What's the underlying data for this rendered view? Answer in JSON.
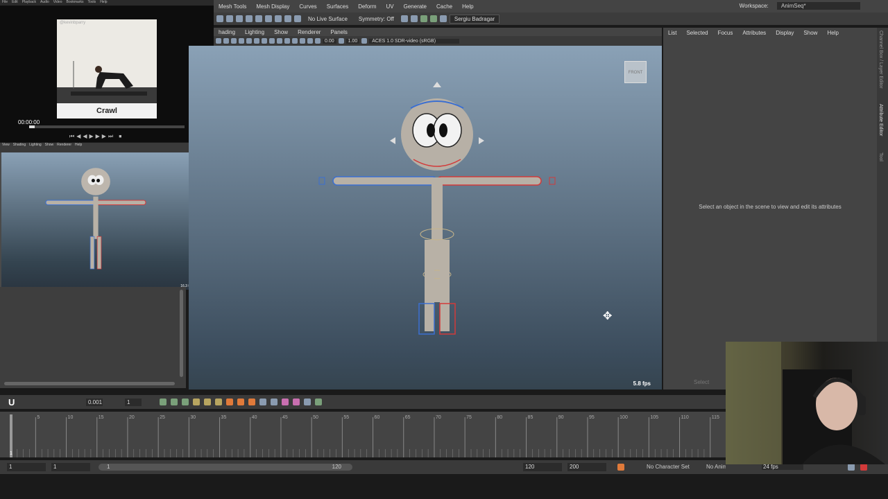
{
  "menubar": {
    "items": [
      "Mesh Tools",
      "Mesh Display",
      "Curves",
      "Surfaces",
      "Deform",
      "UV",
      "Generate",
      "Cache",
      "Help"
    ],
    "workspace_label": "Workspace:",
    "workspace_value": "AnimSeq*"
  },
  "shelf": {
    "live_surface": "No Live Surface",
    "symmetry": "Symmetry: Off",
    "user": "Sergiu Badragar"
  },
  "panel": {
    "menu": [
      "hading",
      "Lighting",
      "Show",
      "Renderer",
      "Panels"
    ],
    "exposure": "0.00",
    "gamma": "1.00",
    "colorspace": "ACES 1.0 SDR-video (sRGB)",
    "fps": "5.8 fps",
    "viewcube": "FRONT"
  },
  "attribute_editor": {
    "menu": [
      "List",
      "Selected",
      "Focus",
      "Attributes",
      "Display",
      "Show",
      "Help"
    ],
    "message": "Select an object in the scene to view and edit its attributes",
    "select_label": "Select",
    "side_tabs": [
      "Channel Box / Layer Editor",
      "Attribute Editor",
      "Tool"
    ]
  },
  "timebar": {
    "u_label": "U",
    "step_value": "0.001",
    "frame_value": "1"
  },
  "timeline": {
    "ticks": [
      "5",
      "10",
      "15",
      "20",
      "25",
      "30",
      "35",
      "40",
      "45",
      "50",
      "55",
      "60",
      "65",
      "70",
      "75",
      "80",
      "85",
      "90",
      "95",
      "100",
      "105",
      "110",
      "115"
    ],
    "current_frame": "1"
  },
  "range": {
    "start": "1",
    "anim_start": "1",
    "slider_start": "1",
    "slider_end": "120",
    "end": "120",
    "anim_end": "200"
  },
  "status": {
    "character_set": "No Character Set",
    "anim_layer": "No Anim Layer",
    "fps": "24 fps"
  },
  "reference": {
    "menu": [
      "File",
      "Edit",
      "Playback",
      "Audio",
      "Video",
      "Bookmarks",
      "Tools",
      "Help"
    ],
    "watermark": "@kevinbparry",
    "caption": "Crawl",
    "time": "00:00:00"
  },
  "mini": {
    "menu": [
      "View",
      "Shading",
      "Lighting",
      "Show",
      "Renderer",
      "Help"
    ],
    "fps": "16.3 fps"
  },
  "colors": {
    "accent_blue": "#3b6fd1",
    "accent_red": "#d23a3a"
  }
}
